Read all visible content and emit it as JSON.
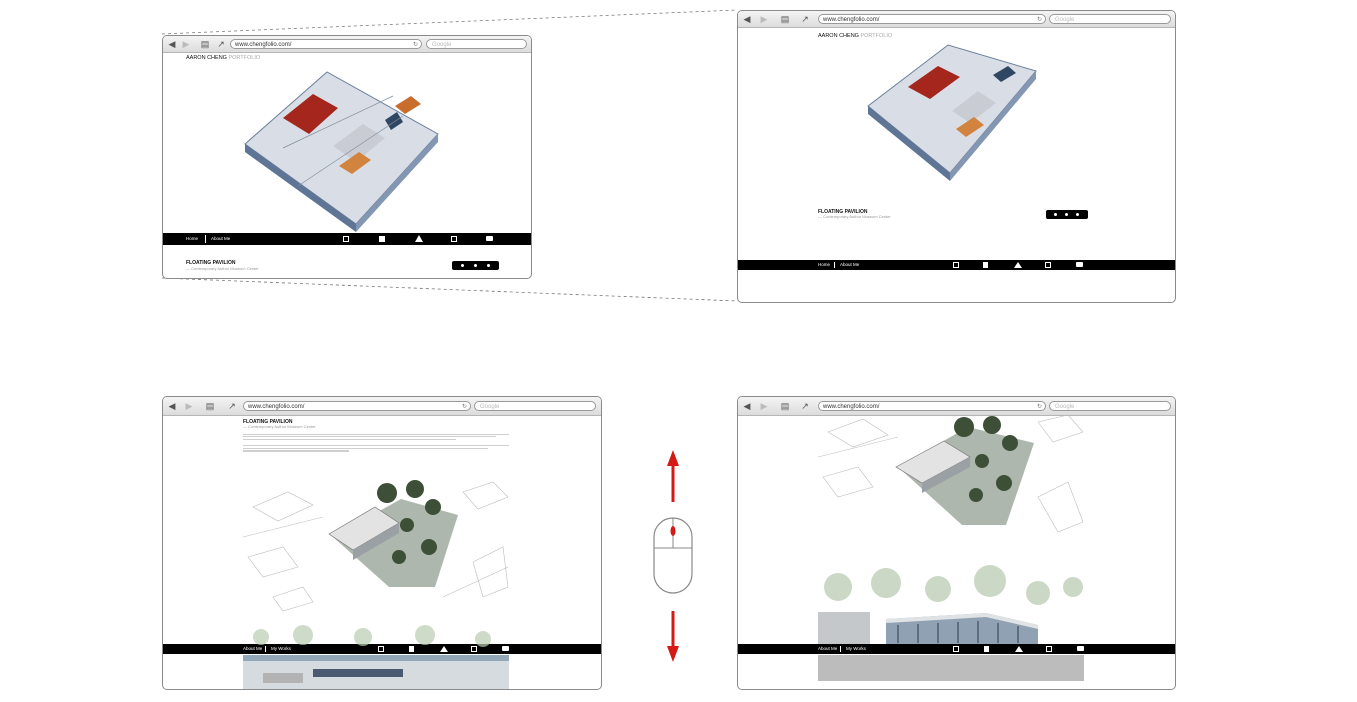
{
  "browser": {
    "url": "www.chengfolio.com/",
    "search_placeholder": "Google",
    "back_glyph": "◀",
    "forward_glyph": "▶",
    "bookmarks_glyph": "📖",
    "share_glyph": "⇪",
    "reload_glyph": "↻"
  },
  "site": {
    "brand_name": "AARON CHENG",
    "brand_suffix": "PORTFOLIO",
    "project_title": "FLOATING PAVILION",
    "project_subtitle": "— Contemporary Authur Museum Center",
    "nav_home": "Home",
    "nav_about": "About Me",
    "nav_works": "My Works"
  },
  "icons": {
    "bar": [
      "folder-icon",
      "book-icon",
      "home-icon",
      "document-icon",
      "chat-icon"
    ]
  },
  "colors": {
    "arrow_red": "#d41a14",
    "mouse_wheel_red": "#d41a14",
    "nav_bar": "#000000",
    "chrome_border": "#8a8a8a"
  },
  "pager": {
    "dots": 3
  }
}
